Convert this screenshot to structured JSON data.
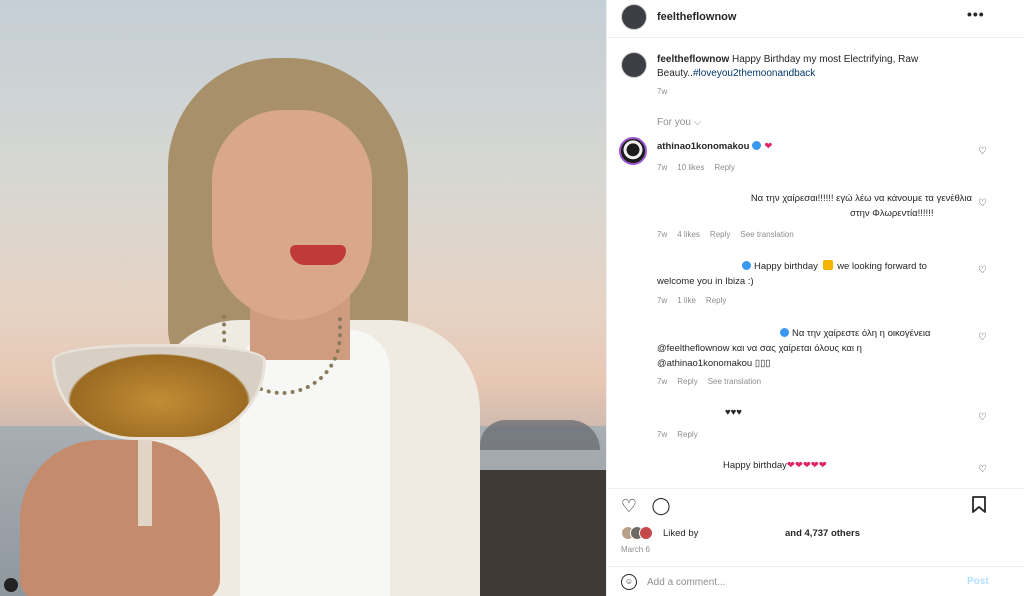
{
  "post": {
    "username": "feeltheflownow",
    "more_icon": "more-horizontal-icon"
  },
  "caption": {
    "username": "feeltheflownow",
    "text": " Happy Birthday my most Electrifying, Raw Beauty..",
    "hashtag": "#loveyou2themoonandback",
    "time": "7w"
  },
  "for_you": "For you ⌵",
  "comments": [
    {
      "username": "athinao1konomakou",
      "text": "❤",
      "time": "7w",
      "likes": "10 likes",
      "reply": "Reply"
    },
    {
      "text_line1": "Να την χαίρεσαι!!!!!! εγώ λέω να κάνουμε τα γενέθλια",
      "text_line2": "στην Φλωρεντία!!!!!!",
      "time": "7w",
      "likes": "4 likes",
      "reply": "Reply",
      "translate": "See translation"
    },
    {
      "text_line1": "Happy birthday",
      "text_line1b": "we looking forward to",
      "text_line2": "welcome you in Ibiza :)",
      "time": "7w",
      "likes": "1 like",
      "reply": "Reply"
    },
    {
      "text_line1": "Να την χαίρεστε όλη η οικογένεια",
      "text_line2": "@feeltheflownow και να σας χαίρεται όλους και η",
      "text_line3": "@athinao1konomakou ▯▯▯",
      "time": "7w",
      "reply": "Reply",
      "translate": "See translation"
    },
    {
      "text": "♥♥♥",
      "time": "7w",
      "reply": "Reply"
    },
    {
      "text": "Happy birthday",
      "hearts": "❤❤❤❤❤"
    }
  ],
  "likes": {
    "liked_by": "Liked by",
    "others": "and 4,737 others"
  },
  "date": "March 6",
  "add_comment": {
    "placeholder": "Add a comment...",
    "post_label": "Post"
  },
  "icons": {
    "like": "heart-icon",
    "comment": "comment-icon",
    "save": "bookmark-icon",
    "emoji": "emoji-icon"
  }
}
